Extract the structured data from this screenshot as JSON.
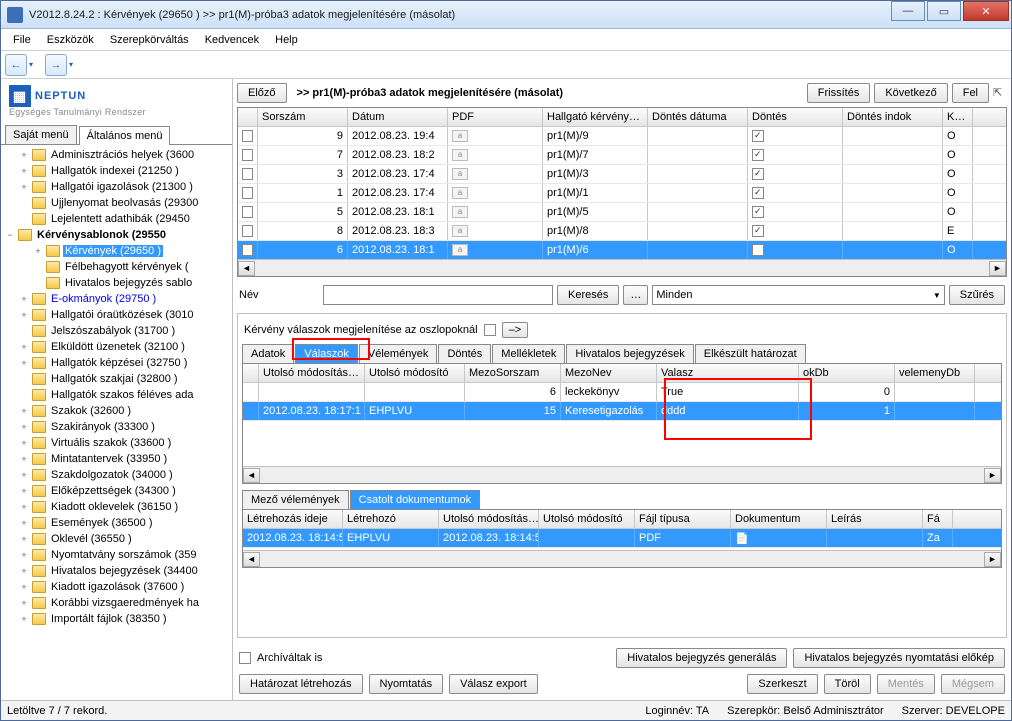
{
  "window": {
    "title": "V2012.8.24.2 : Kérvények (29650  )  >> pr1(M)-próba3 adatok megjelenítésére (másolat)"
  },
  "menu": {
    "file": "File",
    "tools": "Eszközök",
    "role": "Szerepkörváltás",
    "fav": "Kedvencek",
    "help": "Help"
  },
  "logo": {
    "brand": "NEPTUN",
    "sub": "Egységes Tanulmányi Rendszer"
  },
  "lefttabs": {
    "own": "Saját menü",
    "general": "Általános menü"
  },
  "tree": [
    {
      "pad": 18,
      "exp": "+",
      "label": "Adminisztrációs helyek (3600"
    },
    {
      "pad": 18,
      "exp": "+",
      "label": "Hallgatók indexei (21250  )"
    },
    {
      "pad": 18,
      "exp": "+",
      "label": "Hallgatói igazolások (21300  )"
    },
    {
      "pad": 18,
      "exp": "",
      "label": "Ujjlenyomat beolvasás (29300"
    },
    {
      "pad": 18,
      "exp": "",
      "label": "Lejelentett adathibák (29450"
    },
    {
      "pad": 4,
      "exp": "−",
      "label": "Kérvénysablonok (29550",
      "bold": true
    },
    {
      "pad": 32,
      "exp": "+",
      "label": "Kérvények  (29650  )",
      "sel": true
    },
    {
      "pad": 32,
      "exp": "",
      "label": "Félbehagyott kérvények ("
    },
    {
      "pad": 32,
      "exp": "",
      "label": "Hivatalos bejegyzés sablo"
    },
    {
      "pad": 18,
      "exp": "+",
      "label": "E-okmányok (29750  )",
      "blue": true
    },
    {
      "pad": 18,
      "exp": "+",
      "label": "Hallgatói óraütközések (3010"
    },
    {
      "pad": 18,
      "exp": "",
      "label": "Jelszószabályok (31700  )"
    },
    {
      "pad": 18,
      "exp": "+",
      "label": "Elküldött üzenetek (32100  )"
    },
    {
      "pad": 18,
      "exp": "+",
      "label": "Hallgatók képzései (32750  )"
    },
    {
      "pad": 18,
      "exp": "",
      "label": "Hallgatók szakjai (32800  )"
    },
    {
      "pad": 18,
      "exp": "",
      "label": "Hallgatók szakos féléves ada"
    },
    {
      "pad": 18,
      "exp": "+",
      "label": "Szakok (32600  )"
    },
    {
      "pad": 18,
      "exp": "+",
      "label": "Szakirányok (33300  )"
    },
    {
      "pad": 18,
      "exp": "+",
      "label": "Virtuális szakok (33600  )"
    },
    {
      "pad": 18,
      "exp": "+",
      "label": "Mintatantervek (33950  )"
    },
    {
      "pad": 18,
      "exp": "+",
      "label": "Szakdolgozatok (34000  )"
    },
    {
      "pad": 18,
      "exp": "+",
      "label": "Előképzettségek (34300  )"
    },
    {
      "pad": 18,
      "exp": "+",
      "label": "Kiadott oklevelek (36150  )"
    },
    {
      "pad": 18,
      "exp": "+",
      "label": "Események (36500  )"
    },
    {
      "pad": 18,
      "exp": "+",
      "label": "Oklevél (36550  )"
    },
    {
      "pad": 18,
      "exp": "+",
      "label": "Nyomtatvány sorszámok (359"
    },
    {
      "pad": 18,
      "exp": "+",
      "label": "Hivatalos bejegyzések (34400"
    },
    {
      "pad": 18,
      "exp": "+",
      "label": "Kiadott igazolások (37600  )"
    },
    {
      "pad": 18,
      "exp": "+",
      "label": "Korábbi vizsgaeredmények ha"
    },
    {
      "pad": 18,
      "exp": "+",
      "label": "Importált fájlok (38350  )"
    }
  ],
  "top": {
    "prev": "Előző",
    "title": ">> pr1(M)-próba3 adatok megjelenítésére (másolat)",
    "refresh": "Frissítés",
    "next": "Következő",
    "up": "Fel"
  },
  "grid": {
    "cols": [
      "",
      "Sorszám",
      "Dátum",
      "PDF",
      "Hallgató kérvény…",
      "Döntés dátuma",
      "Döntés",
      "Döntés indok",
      "K…"
    ],
    "rows": [
      {
        "sor": "9",
        "dat": "2012.08.23. 19:4",
        "hk": "pr1(M)/9",
        "d": true,
        "k": "O"
      },
      {
        "sor": "7",
        "dat": "2012.08.23. 18:2",
        "hk": "pr1(M)/7",
        "d": true,
        "k": "O"
      },
      {
        "sor": "3",
        "dat": "2012.08.23. 17:4",
        "hk": "pr1(M)/3",
        "d": true,
        "k": "O"
      },
      {
        "sor": "1",
        "dat": "2012.08.23. 17:4",
        "hk": "pr1(M)/1",
        "d": true,
        "k": "O"
      },
      {
        "sor": "5",
        "dat": "2012.08.23. 18:1",
        "hk": "pr1(M)/5",
        "d": true,
        "k": "O"
      },
      {
        "sor": "8",
        "dat": "2012.08.23. 18:3",
        "hk": "pr1(M)/8",
        "d": true,
        "k": "E"
      },
      {
        "sor": "6",
        "dat": "2012.08.23. 18:1",
        "hk": "pr1(M)/6",
        "d": true,
        "k": "O",
        "sel": true
      }
    ]
  },
  "search": {
    "label": "Név",
    "btn": "Keresés",
    "dots": "…",
    "all": "Minden",
    "filter": "Szűrés"
  },
  "opt": {
    "label": "Kérvény válaszok megjelenítése az oszlopoknál",
    "arrow": "–>"
  },
  "tabs1": [
    "Adatok",
    "Válaszok",
    "Vélemények",
    "Döntés",
    "Mellékletek",
    "Hivatalos bejegyzések",
    "Elkészült határozat"
  ],
  "tabs1_active": 1,
  "sub1": {
    "cols": [
      "",
      "Utolsó módosítás…",
      "Utolsó módosító",
      "MezoSorszam",
      "MezoNev",
      "Valasz",
      "okDb",
      "velemenyDb"
    ],
    "rows": [
      {
        "um": "",
        "umod": "",
        "ms": "6",
        "mn": "leckekönyv",
        "v": "True",
        "ok": "0",
        "vd": ""
      },
      {
        "um": "2012.08.23. 18:17:1",
        "umod": "EHPLVU",
        "ms": "15",
        "mn": "Keresetigazolás",
        "v": "dddd",
        "ok": "1",
        "vd": "",
        "sel": true
      }
    ]
  },
  "tabs2": [
    "Mező vélemények",
    "Csatolt dokumentumok"
  ],
  "tabs2_active": 1,
  "sub2": {
    "cols": [
      "Létrehozás ideje",
      "Létrehozó",
      "Utolsó módosítás…",
      "Utolsó módosító",
      "Fájl típusa",
      "Dokumentum",
      "Leírás",
      "Fá"
    ],
    "rows": [
      {
        "li": "2012.08.23. 18:14:5",
        "lh": "EHPLVU",
        "um": "2012.08.23. 18:14:5",
        "umod": "",
        "ft": "PDF",
        "dok": "📄",
        "le": "",
        "fa": "Za",
        "sel": true
      }
    ]
  },
  "bottom": {
    "arch": "Archíváltak is",
    "gen": "Hivatalos bejegyzés generálás",
    "print_prev": "Hivatalos bejegyzés nyomtatási előkép",
    "hat": "Határozat létrehozás",
    "ny": "Nyomtatás",
    "ve": "Válasz export",
    "szerk": "Szerkeszt",
    "torol": "Töröl",
    "mentes": "Mentés",
    "megsem": "Mégsem"
  },
  "status": {
    "rec": "Letöltve 7 / 7 rekord.",
    "login": "Loginnév: TA",
    "role": "Szerepkör: Belső Adminisztrátor",
    "server": "Szerver: DEVELOPE"
  }
}
